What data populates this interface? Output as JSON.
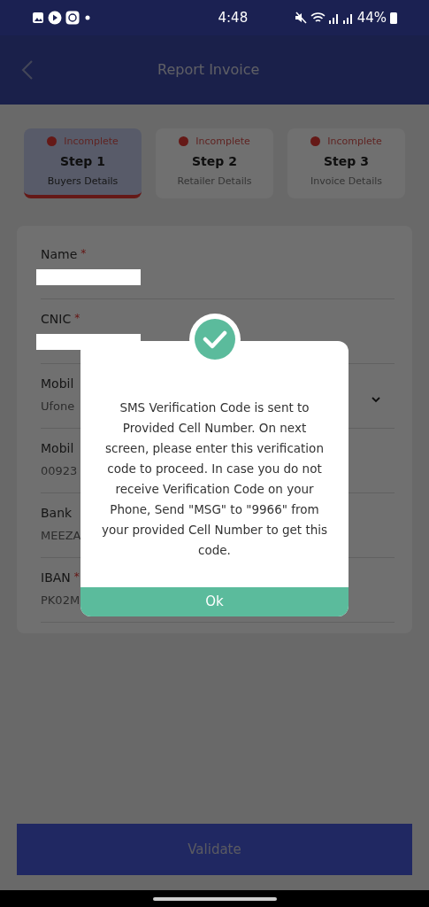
{
  "status_bar": {
    "time": "4:48",
    "battery": "44%"
  },
  "header": {
    "title": "Report Invoice"
  },
  "steps": [
    {
      "status": "Incomplete",
      "title": "Step 1",
      "subtitle": "Buyers Details",
      "selected": true
    },
    {
      "status": "Incomplete",
      "title": "Step 2",
      "subtitle": "Retailer Details",
      "selected": false
    },
    {
      "status": "Incomplete",
      "title": "Step 3",
      "subtitle": "Invoice Details",
      "selected": false
    }
  ],
  "form": {
    "fields": [
      {
        "kind": "redacted",
        "label": "Name",
        "required_mark": "*"
      },
      {
        "kind": "redacted",
        "label": "CNIC",
        "required_mark": "*"
      },
      {
        "kind": "dropdown",
        "label": "Mobil",
        "value": "Ufone"
      },
      {
        "kind": "text",
        "label": "Mobil",
        "value": "00923"
      },
      {
        "kind": "text",
        "label": "Bank",
        "value": "MEEZA"
      },
      {
        "kind": "text",
        "label": "IBAN",
        "value": "PK02M",
        "required_mark": "*"
      }
    ]
  },
  "validate_button": "Validate",
  "dialog": {
    "message": "SMS Verification Code is sent to Provided Cell Number. On next screen, please enter this verification code to proceed. In case you do not receive Verification Code on your Phone, Send \"MSG\" to \"9966\" from your provided Cell Number to get this code.",
    "button": "Ok"
  }
}
